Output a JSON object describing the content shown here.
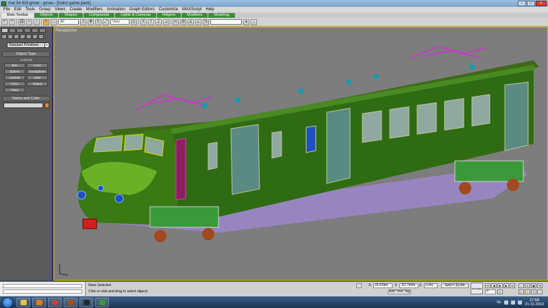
{
  "window": {
    "title": "mat 54 8Gl.gmax - gmax - [trainz game pack]",
    "controls": [
      "–",
      "□",
      "×"
    ]
  },
  "menu": [
    "File",
    "Edit",
    "Tools",
    "Group",
    "Views",
    "Create",
    "Modifiers",
    "Animation",
    "Graph Editors",
    "Customize",
    "MAXScript",
    "Help"
  ],
  "tabs": [
    {
      "label": "Main Toolbar",
      "active": true
    },
    {
      "label": "Objects",
      "active": false
    },
    {
      "label": "Shapes",
      "active": false
    },
    {
      "label": "Compounds",
      "active": false
    },
    {
      "label": "Lights & Cameras",
      "active": false
    },
    {
      "label": "Helpers",
      "active": false
    },
    {
      "label": "Modifiers",
      "active": false
    },
    {
      "label": "Modeling",
      "active": false
    }
  ],
  "toolbar": {
    "selection_filter": "All",
    "reference_coord": "View",
    "named_selection": ""
  },
  "command_panel": {
    "category": "Standard Primitives",
    "object_type_title": "Object Type",
    "autogrid": "AutoGrid",
    "objects": [
      "Box",
      "Cone",
      "Sphere",
      "GeoSphere",
      "Cylinder",
      "Tube",
      "Torus",
      "Teapot",
      "Plane"
    ],
    "name_color_title": "Name and Color",
    "color": "#e08a30"
  },
  "viewport": {
    "label": "Perspective"
  },
  "status": {
    "selection": "None Selected",
    "prompt": "Click or click-and-drag to select objects",
    "x_label": "X:",
    "x_value": "24.639m",
    "y_label": "Y:",
    "y_value": "-52.799m",
    "z_label": "Z:",
    "z_value": "0.0m",
    "grid": "Grid = 10.0m",
    "add_time_tag": "Add Time Tag",
    "animate": "Animate",
    "frame": "0"
  },
  "taskbar": {
    "language": "NL",
    "time": "17:58",
    "date": "21-11-2013"
  }
}
